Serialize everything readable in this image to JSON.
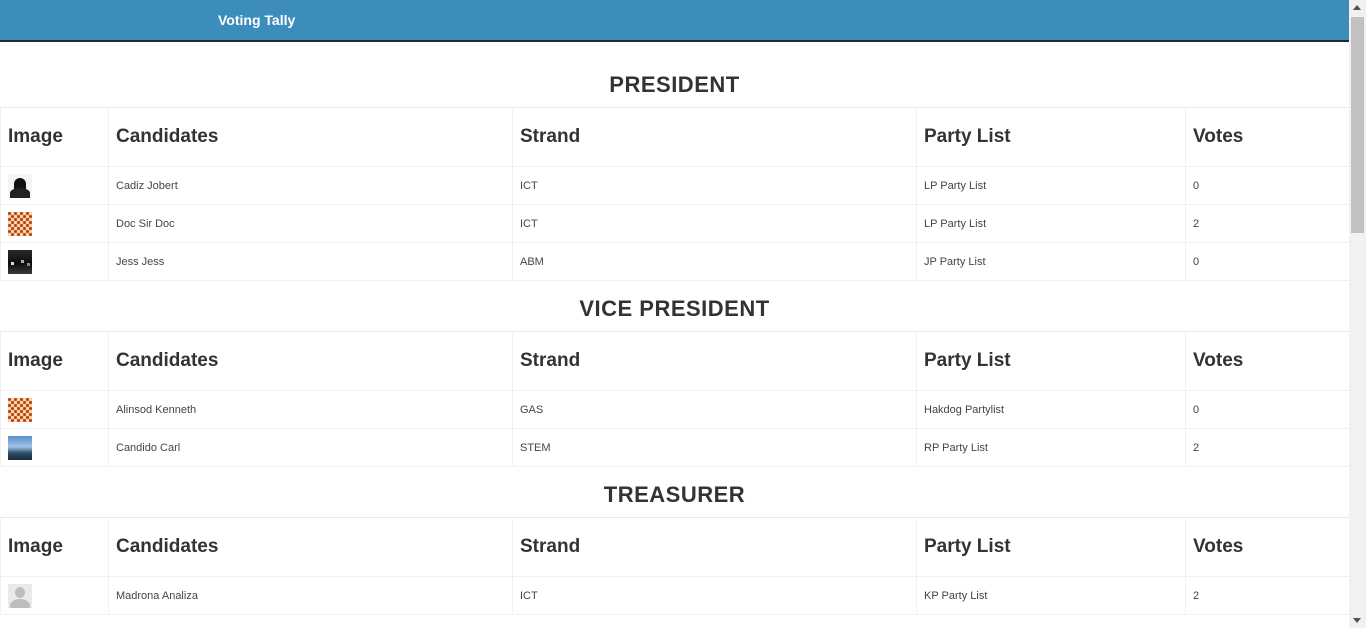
{
  "app": {
    "brand": "Voting Tally",
    "accent_color": "#3c8dbc"
  },
  "table_headers": {
    "image": "Image",
    "candidates": "Candidates",
    "strand": "Strand",
    "party_list": "Party List",
    "votes": "Votes"
  },
  "sections": [
    {
      "title": "PRESIDENT",
      "rows": [
        {
          "image_icon": "dark-silhouette-photo",
          "candidate": "Cadiz Jobert",
          "strand": "ICT",
          "party_list": "LP Party List",
          "votes": "0"
        },
        {
          "image_icon": "pattern-photo",
          "candidate": "Doc Sir Doc",
          "strand": "ICT",
          "party_list": "LP Party List",
          "votes": "2"
        },
        {
          "image_icon": "night-scene-photo",
          "candidate": "Jess Jess",
          "strand": "ABM",
          "party_list": "JP Party List",
          "votes": "0"
        }
      ]
    },
    {
      "title": "VICE PRESIDENT",
      "rows": [
        {
          "image_icon": "pattern-photo",
          "candidate": "Alinsod Kenneth",
          "strand": "GAS",
          "party_list": "Hakdog Partylist",
          "votes": "0"
        },
        {
          "image_icon": "sky-photo",
          "candidate": "Candido Carl",
          "strand": "STEM",
          "party_list": "RP Party List",
          "votes": "2"
        }
      ]
    },
    {
      "title": "TREASURER",
      "rows": [
        {
          "image_icon": "default-avatar-photo",
          "candidate": "Madrona Analiza",
          "strand": "ICT",
          "party_list": "KP Party List",
          "votes": "2"
        }
      ]
    }
  ]
}
